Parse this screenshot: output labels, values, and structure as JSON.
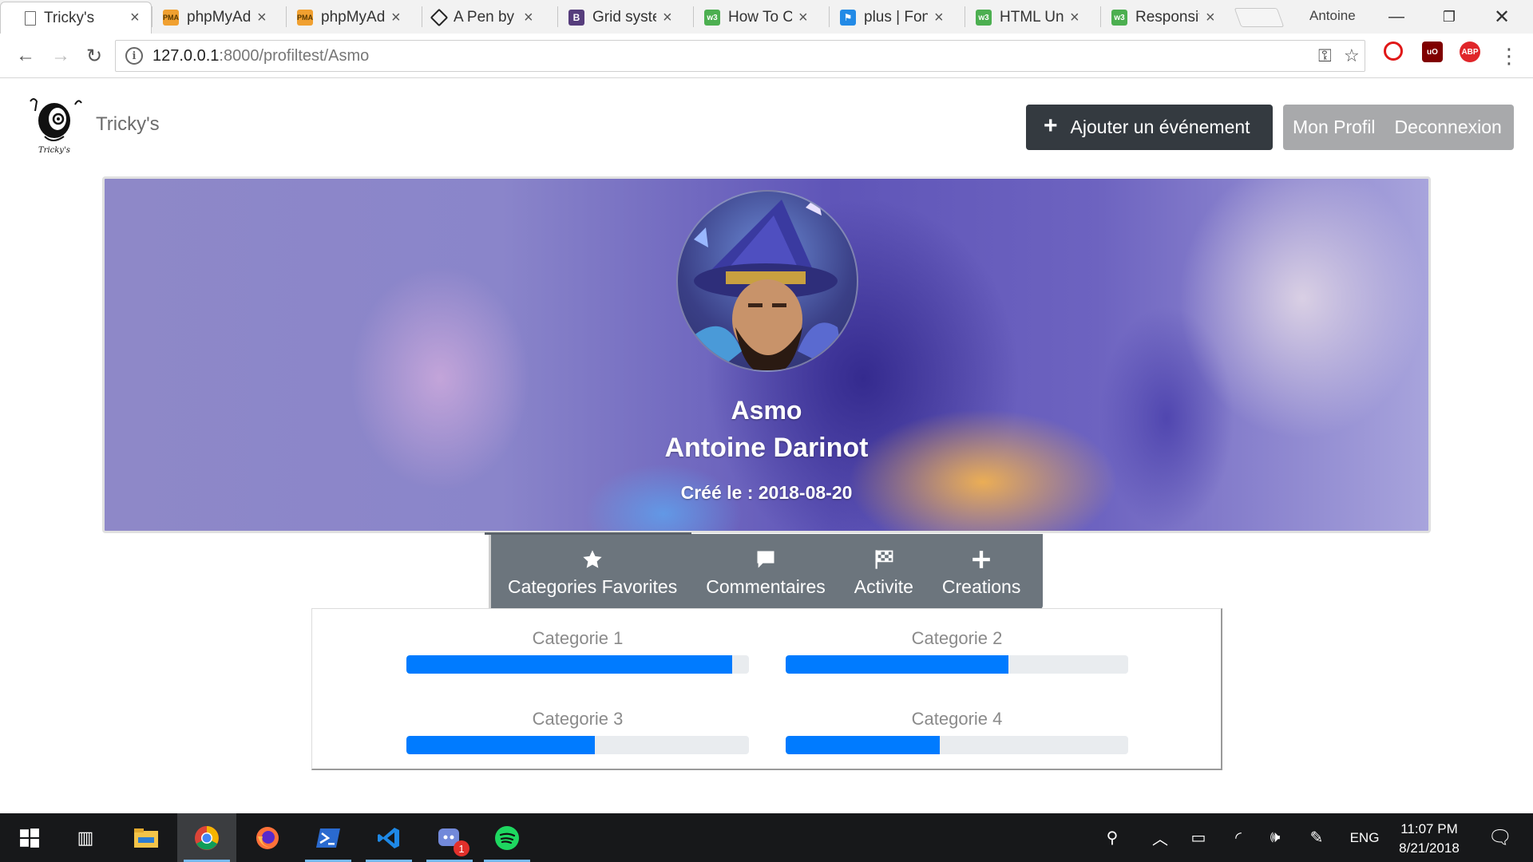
{
  "browser": {
    "tabs": [
      {
        "title": "Tricky's",
        "favicon": "page-icon",
        "color": "#ffffff"
      },
      {
        "title": "phpMyAd",
        "favicon": "phpmyadmin-icon",
        "color": "#f0a030"
      },
      {
        "title": "phpMyAd",
        "favicon": "phpmyadmin-icon",
        "color": "#f0a030"
      },
      {
        "title": "A Pen by",
        "favicon": "codepen-icon",
        "color": "#222222"
      },
      {
        "title": "Grid syste",
        "favicon": "bootstrap-icon",
        "color": "#563d7c"
      },
      {
        "title": "How To Cr",
        "favicon": "w3schools-icon",
        "color": "#4caf50"
      },
      {
        "title": "plus | Font",
        "favicon": "fontawesome-icon",
        "color": "#228ae6"
      },
      {
        "title": "HTML Uni",
        "favicon": "w3schools-icon",
        "color": "#4caf50"
      },
      {
        "title": "Responsiv",
        "favicon": "w3schools-icon",
        "color": "#4caf50"
      }
    ],
    "profile_name": "Antoine",
    "url_host": "127.0.0.1",
    "url_path": ":8000/profiltest/Asmo"
  },
  "site": {
    "brand_name": "Tricky's",
    "logo_caption": "Tricky's",
    "add_event_label": "Ajouter un événement",
    "my_profile_label": "Mon Profil",
    "logout_label": "Deconnexion"
  },
  "profile": {
    "username": "Asmo",
    "full_name": "Antoine Darinot",
    "created": "Créé le : 2018-08-20"
  },
  "profile_tabs": [
    {
      "label": "Categories Favorites",
      "icon": "star-icon",
      "active": true
    },
    {
      "label": "Commentaires",
      "icon": "comment-icon",
      "active": false
    },
    {
      "label": "Activite",
      "icon": "checkered-flag-icon",
      "active": false
    },
    {
      "label": "Creations",
      "icon": "plus-icon",
      "active": false
    }
  ],
  "categories": [
    {
      "label": "Categorie 1",
      "progress": 0.95
    },
    {
      "label": "Categorie 2",
      "progress": 0.65
    },
    {
      "label": "Categorie 3",
      "progress": 0.55
    },
    {
      "label": "Categorie 4",
      "progress": 0.45
    }
  ],
  "taskbar": {
    "time": "11:07 PM",
    "date": "8/21/2018",
    "language": "ENG",
    "discord_badge": "1",
    "apps": [
      "windows-start-icon",
      "task-view-icon",
      "file-explorer-icon",
      "chrome-icon",
      "firefox-icon",
      "powershell-icon",
      "vscode-icon",
      "discord-icon",
      "spotify-icon"
    ]
  },
  "colors": {
    "progress": "#007bff",
    "dark_button": "#343a40",
    "secondary": "#6c757d"
  }
}
